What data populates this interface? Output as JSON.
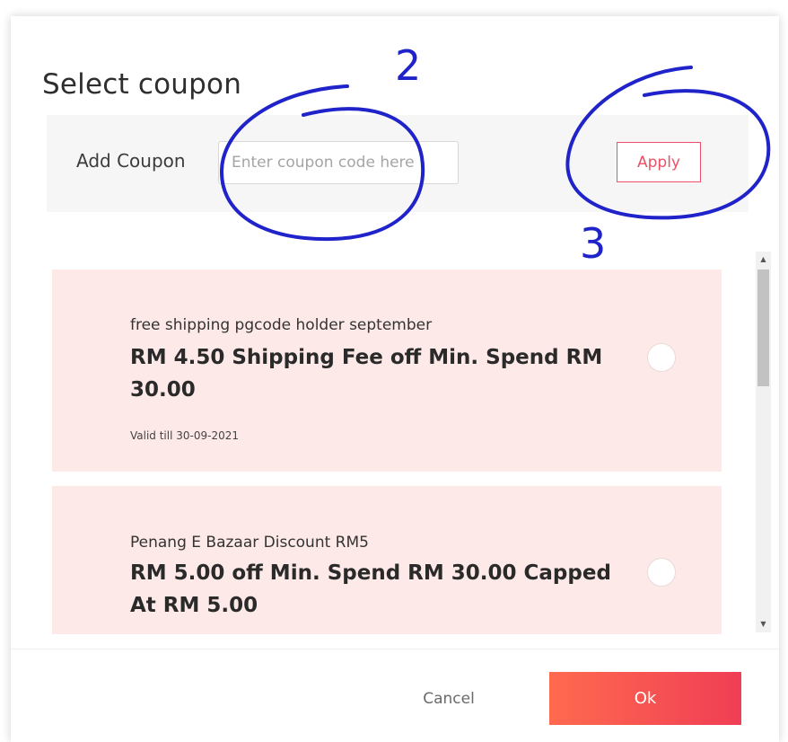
{
  "dialog": {
    "title": "Select coupon"
  },
  "coupon_entry": {
    "label": "Add Coupon",
    "placeholder": "Enter coupon code here",
    "value": "",
    "apply_label": "Apply"
  },
  "coupons": [
    {
      "name": "free shipping pgcode holder september",
      "description": "RM 4.50 Shipping Fee off Min. Spend RM 30.00",
      "validity": "Valid till 30-09-2021",
      "selected": false
    },
    {
      "name": "Penang E Bazaar Discount RM5",
      "description": "RM 5.00 off Min. Spend RM 30.00 Capped At RM 5.00",
      "selected": false
    }
  ],
  "footer": {
    "cancel_label": "Cancel",
    "ok_label": "Ok"
  },
  "annotations": {
    "label_2": "2",
    "label_3": "3",
    "color": "#1f23c9"
  },
  "colors": {
    "accent": "#ef4f65",
    "ok_gradient_start": "#ff6a4f",
    "ok_gradient_end": "#f03e55",
    "card_background": "#fde9e7"
  }
}
